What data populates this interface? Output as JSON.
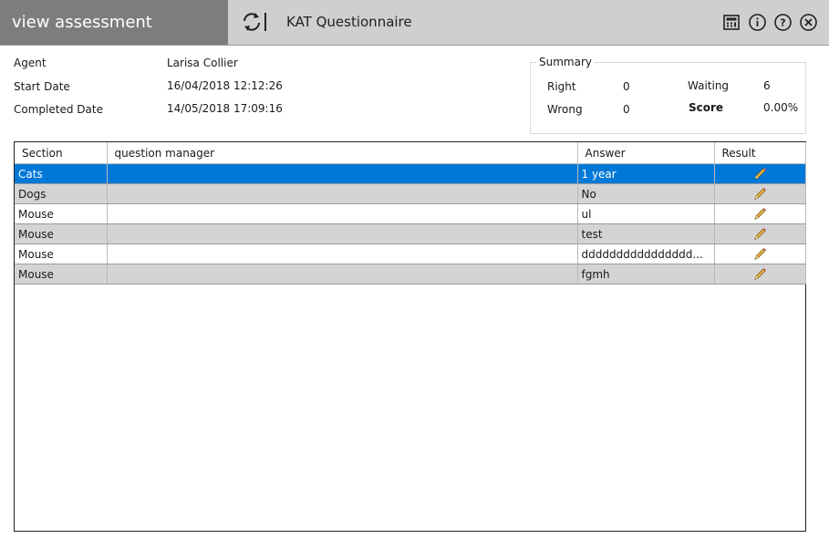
{
  "header": {
    "section_title": "view assessment",
    "app_title": "KAT Questionnaire",
    "icons": [
      "refresh-icon",
      "calculator-icon",
      "info-icon",
      "help-icon",
      "close-icon"
    ]
  },
  "details": {
    "agent_label": "Agent",
    "agent_value": "Larisa Collier",
    "start_label": "Start Date",
    "start_value": "16/04/2018 12:12:26",
    "completed_label": "Completed Date",
    "completed_value": "14/05/2018 17:09:16"
  },
  "summary": {
    "legend": "Summary",
    "right_label": "Right",
    "right_value": "0",
    "wrong_label": "Wrong",
    "wrong_value": "0",
    "waiting_label": "Waiting",
    "waiting_value": "6",
    "score_label": "Score",
    "score_value": "0.00%"
  },
  "grid": {
    "columns": [
      "Section",
      "question manager",
      "Answer",
      "Result"
    ],
    "rows": [
      {
        "section": "Cats",
        "question": "",
        "answer": "1 year",
        "selected": true
      },
      {
        "section": "Dogs",
        "question": "",
        "answer": "No",
        "selected": false
      },
      {
        "section": "Mouse",
        "question": "",
        "answer": "ul",
        "selected": false
      },
      {
        "section": "Mouse",
        "question": "",
        "answer": "test",
        "selected": false
      },
      {
        "section": "Mouse",
        "question": "",
        "answer": "dddddddddddddddd...",
        "selected": false
      },
      {
        "section": "Mouse",
        "question": "",
        "answer": "fgmh",
        "selected": false
      }
    ]
  },
  "colors": {
    "selected_row": "#0078d7",
    "title_left_bg": "#7d7d7d",
    "titlebar_bg": "#cfcfcf"
  }
}
